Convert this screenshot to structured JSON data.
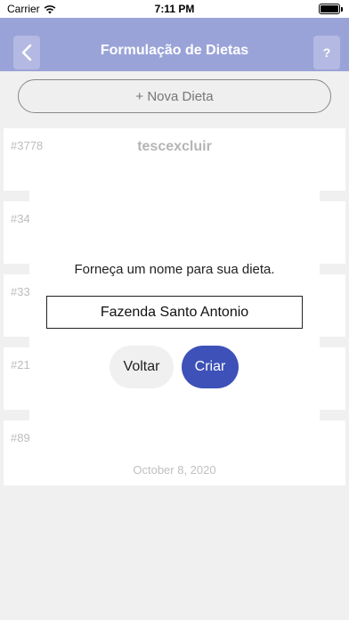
{
  "status_bar": {
    "carrier": "Carrier",
    "time": "7:11 PM",
    "wifi_icon": "wifi-icon",
    "battery_icon": "battery-icon"
  },
  "header": {
    "title": "Formulação de Dietas",
    "back_icon": "chevron-left-icon",
    "help_label": "?",
    "background_color": "#9aa3d8"
  },
  "new_diet_button": {
    "label": "+ Nova Dieta"
  },
  "diet_cards": [
    {
      "id": "#3778",
      "name": "tescexcluir",
      "date": ""
    },
    {
      "id": "#34",
      "name": "",
      "date": ""
    },
    {
      "id": "#33",
      "name": "",
      "date": ""
    },
    {
      "id": "#21",
      "name": "",
      "date": ""
    },
    {
      "id": "#89",
      "name": "",
      "date": "October 8, 2020"
    }
  ],
  "dialog": {
    "prompt": "Forneça um nome para sua dieta.",
    "input_value": "Fazenda Santo Antonio",
    "cancel_label": "Voltar",
    "create_label": "Criar",
    "create_color": "#3d51b8"
  }
}
